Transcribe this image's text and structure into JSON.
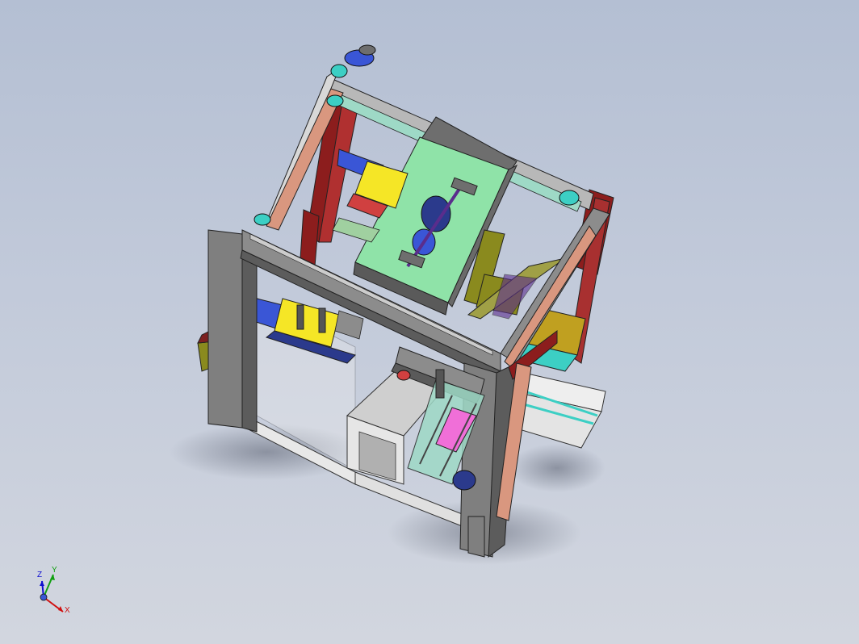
{
  "viewport": {
    "background_top": "#b4bfd3",
    "background_bottom": "#d2d6df"
  },
  "model": {
    "frame_color": "#7f7f7f",
    "accent_colors": {
      "red": "#8c1d1d",
      "salmon": "#d9977f",
      "green": "#8fe3a8",
      "yellow": "#f5e626",
      "blue": "#3a56d6",
      "olive": "#8a8a1e",
      "teal": "#3ccfc4",
      "pink": "#f06fd8",
      "dark_blue": "#2b3a8c",
      "light_gray": "#ececec"
    }
  },
  "triad": {
    "z_label": "Z",
    "y_label": "Y",
    "x_label": "X",
    "x_color": "#d01010",
    "y_color": "#10a010",
    "z_color": "#1010d0"
  }
}
